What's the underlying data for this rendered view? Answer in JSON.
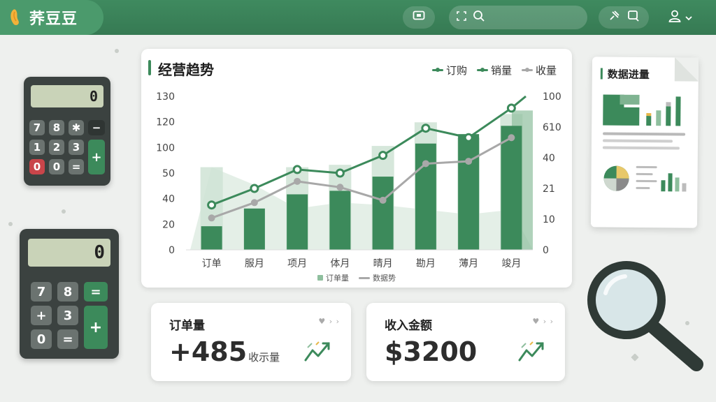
{
  "header": {
    "brand": "荞豆豆",
    "search_placeholder": ""
  },
  "colors": {
    "primary": "#3c8a5b",
    "primary_light": "#a9cdb5",
    "gray_line": "#a8a8a8",
    "topbar": "#3f8a5f"
  },
  "chart": {
    "title": "经营趋势",
    "legend_top": [
      "订购",
      "销量",
      "收量"
    ],
    "legend_bottom": [
      "订单量",
      "数据势"
    ]
  },
  "chart_data": {
    "type": "bar",
    "title": "经营趋势",
    "categories": [
      "订单",
      "服月",
      "项月",
      "体月",
      "晴月",
      "勘月",
      "薄月",
      "竣月"
    ],
    "y_left_ticks": [
      "0",
      "20",
      "40",
      "50",
      "100",
      "120",
      "130"
    ],
    "y_right_ticks": [
      "0",
      "10",
      "21",
      "40",
      "610",
      "100"
    ],
    "ylim": [
      0,
      130
    ],
    "series": [
      {
        "name": "订单量",
        "type": "bar",
        "values": [
          20,
          35,
          47,
          50,
          62,
          90,
          98,
          105
        ]
      },
      {
        "name": "订购",
        "type": "line",
        "values": [
          38,
          52,
          68,
          65,
          80,
          103,
          95,
          120
        ]
      },
      {
        "name": "数据势",
        "type": "line",
        "values": [
          27,
          40,
          58,
          53,
          42,
          73,
          75,
          95
        ]
      }
    ],
    "background_bars": [
      70,
      0,
      70,
      72,
      88,
      108,
      95,
      115
    ],
    "background_band": [
      70,
      55,
      35,
      40,
      38,
      34,
      30,
      34
    ]
  },
  "stats": [
    {
      "label": "订单量",
      "value": "+485",
      "unit": "收示量",
      "menu": "♥ › ›"
    },
    {
      "label": "收入金额",
      "value": "$3200",
      "unit": "",
      "menu": "♥ › ›"
    }
  ],
  "report": {
    "title": "数据进量"
  },
  "calc1": {
    "display": "0",
    "keys": [
      "7",
      "8",
      "✱",
      "−",
      "1",
      "2",
      "3",
      "+",
      "0",
      "0",
      "="
    ]
  },
  "calc2": {
    "display": "0",
    "keys": [
      "7",
      "8",
      "=",
      "+",
      "3",
      "+",
      "0",
      "="
    ]
  }
}
